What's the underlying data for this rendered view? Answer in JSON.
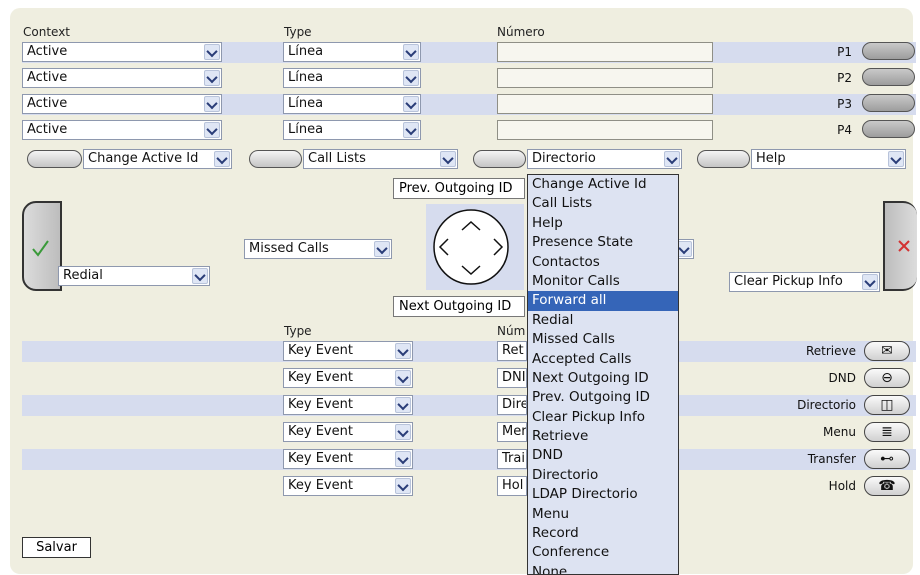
{
  "top": {
    "headers": {
      "context": "Context",
      "type": "Type",
      "numero": "Número"
    },
    "rows": [
      {
        "context": "Active",
        "type": "Línea",
        "number": "",
        "label": "P1"
      },
      {
        "context": "Active",
        "type": "Línea",
        "number": "",
        "label": "P2"
      },
      {
        "context": "Active",
        "type": "Línea",
        "number": "",
        "label": "P3"
      },
      {
        "context": "Active",
        "type": "Línea",
        "number": "",
        "label": "P4"
      }
    ]
  },
  "softkeys": [
    "Change Active Id",
    "Call Lists",
    "Directorio",
    "Help"
  ],
  "nav": {
    "prev_outgoing": "Prev. Outgoing ID",
    "next_outgoing": "Next Outgoing ID",
    "left_select": "Missed Calls",
    "green_select": "Redial",
    "red_select": "Clear Pickup Info"
  },
  "dropdown": {
    "options": [
      "Change Active Id",
      "Call Lists",
      "Help",
      "Presence State",
      "Contactos",
      "Monitor Calls",
      "Forward all",
      "Redial",
      "Missed Calls",
      "Accepted Calls",
      "Next Outgoing ID",
      "Prev. Outgoing ID",
      "Clear Pickup Info",
      "Retrieve",
      "DND",
      "Directorio",
      "LDAP Directorio",
      "Menu",
      "Record",
      "Conference",
      "None"
    ],
    "highlighted": "Forward all"
  },
  "bottom": {
    "headers": {
      "type": "Type",
      "numero": "Núm"
    },
    "rows": [
      {
        "type": "Key Event",
        "number": "Ret",
        "label": "Retrieve",
        "icon": "envelope-icon"
      },
      {
        "type": "Key Event",
        "number": "DNI",
        "label": "DND",
        "icon": "dnd-icon"
      },
      {
        "type": "Key Event",
        "number": "Dire",
        "label": "Directorio",
        "icon": "book-icon"
      },
      {
        "type": "Key Event",
        "number": "Mer",
        "label": "Menu",
        "icon": "menu-icon"
      },
      {
        "type": "Key Event",
        "number": "Trai",
        "label": "Transfer",
        "icon": "transfer-icon"
      },
      {
        "type": "Key Event",
        "number": "Hol",
        "label": "Hold",
        "icon": "hold-icon"
      }
    ]
  },
  "save_label": "Salvar",
  "colors": {
    "band": "#d6dcee",
    "panel": "#efeee0",
    "highlight": "#3565b8",
    "green_check": "#3a9a3a",
    "red_x": "#d33333"
  }
}
